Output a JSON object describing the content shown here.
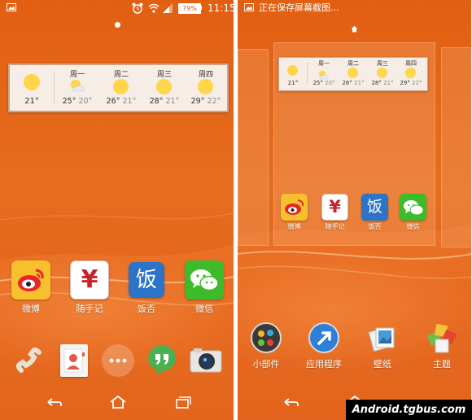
{
  "status_bar_left": {
    "time": "11:15",
    "battery": "79%"
  },
  "status_bar_right": {
    "notification": "正在保存屏幕截图..."
  },
  "weather_widget": {
    "today": {
      "day": "",
      "high": "21°",
      "low": ""
    },
    "forecast": [
      {
        "day": "周一",
        "high": "25°",
        "low": "20°",
        "icon": "partly-cloudy-icon"
      },
      {
        "day": "周二",
        "high": "26°",
        "low": "21°",
        "icon": "sun-icon"
      },
      {
        "day": "周三",
        "high": "28°",
        "low": "21°",
        "icon": "sun-icon"
      },
      {
        "day": "周四",
        "high": "29°",
        "low": "22°",
        "icon": "sun-icon"
      }
    ]
  },
  "apps": [
    {
      "label": "微博",
      "icon": "weibo-icon",
      "color": "#f6c12c"
    },
    {
      "label": "随手记",
      "icon": "yen-icon",
      "color": "#ffffff"
    },
    {
      "label": "饭否",
      "icon": "fanfou-icon",
      "color": "#2d74c9"
    },
    {
      "label": "微信",
      "icon": "wechat-icon",
      "color": "#3dbb2b"
    }
  ],
  "dock": [
    {
      "icon": "phone-icon"
    },
    {
      "icon": "contacts-icon"
    },
    {
      "icon": "app-drawer-icon"
    },
    {
      "icon": "hangouts-icon"
    },
    {
      "icon": "camera-icon"
    }
  ],
  "editor_tools": [
    {
      "label": "小部件",
      "icon": "widgets-icon"
    },
    {
      "label": "应用程序",
      "icon": "apps-icon"
    },
    {
      "label": "壁纸",
      "icon": "wallpaper-icon"
    },
    {
      "label": "主题",
      "icon": "themes-icon"
    }
  ],
  "watermark": "Android.tgbus.com",
  "colors": {
    "wallpaper": "#e2621a",
    "widget_bg": "#f5ede6",
    "widget_border": "#cfa383",
    "sun": "#ffd54a"
  }
}
